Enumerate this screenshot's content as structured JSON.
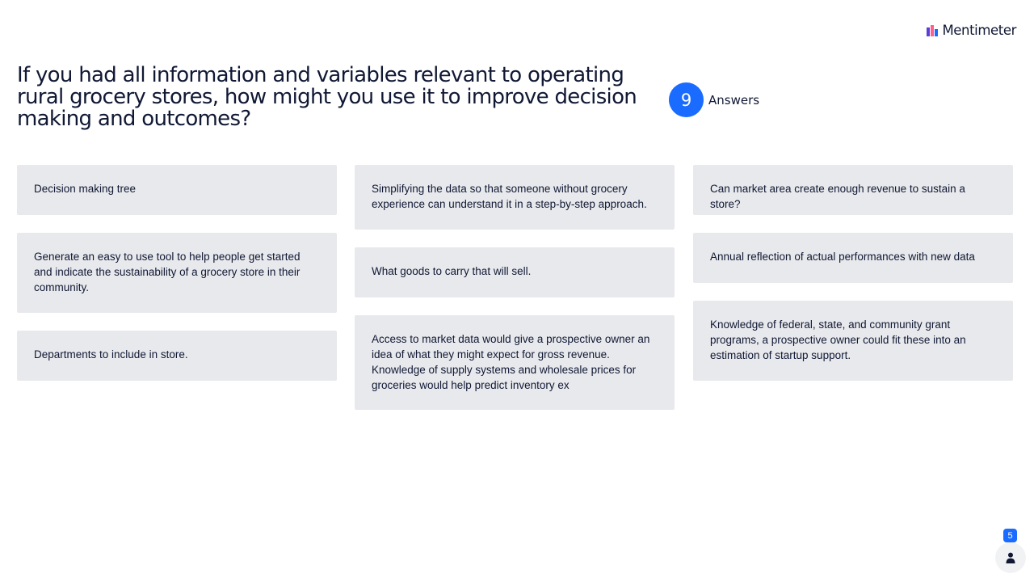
{
  "brand": {
    "name": "Mentimeter",
    "logo_icon": "mentimeter-logo-icon",
    "accent_color": "#196cff"
  },
  "question": {
    "text": "If you had all information and variables relevant to operating rural grocery stores, how might you use it to improve decision making and outcomes?"
  },
  "answers": {
    "count": "9",
    "label": "Answers"
  },
  "columns": [
    {
      "cards": [
        {
          "text": "Decision making tree"
        },
        {
          "text": "Generate an easy to use tool to help people get started and indicate the sustainability of a grocery store in their community."
        },
        {
          "text": "Departments to include in store."
        }
      ]
    },
    {
      "cards": [
        {
          "text": "Simplifying the data so that someone without grocery experience can understand it in a step-by-step approach."
        },
        {
          "text": "What goods to carry that will sell."
        },
        {
          "text": "Access to market data would give a prospective owner an idea of what they might expect for gross revenue. Knowledge of supply systems and wholesale prices for groceries would help predict inventory ex"
        }
      ]
    },
    {
      "cards": [
        {
          "text": "Can market area create enough revenue to sustain a store?"
        },
        {
          "text": "Annual reflection of actual performances with new data"
        },
        {
          "text": "Knowledge of federal, state, and community grant programs, a prospective owner could fit these into an estimation of startup support."
        }
      ]
    }
  ],
  "participants": {
    "count": "5",
    "icon": "person-icon"
  }
}
